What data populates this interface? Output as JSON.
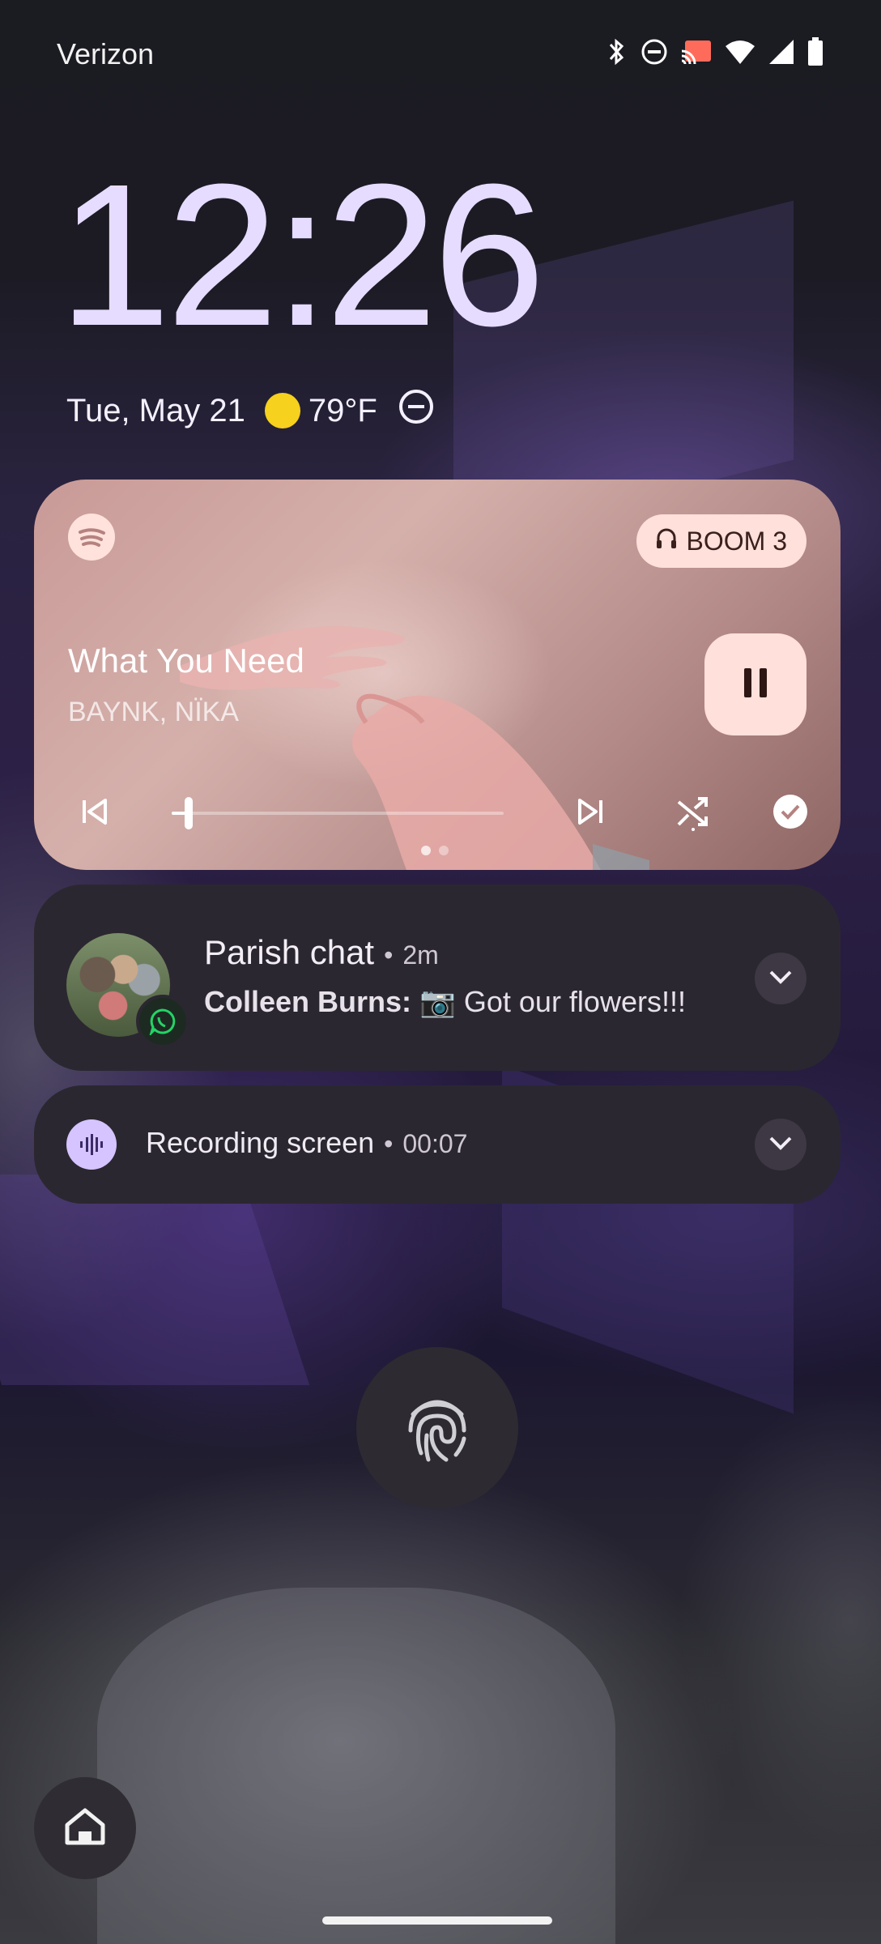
{
  "status_bar": {
    "carrier": "Verizon",
    "icons": [
      "bluetooth-icon",
      "do-not-disturb-icon",
      "cast-icon",
      "wifi-icon",
      "cell-signal-icon",
      "battery-icon"
    ]
  },
  "lockscreen": {
    "time": "12:26",
    "date": "Tue, May 21",
    "weather_icon": "sun-icon",
    "temperature": "79°F",
    "dnd_icon": "do-not-disturb-icon"
  },
  "media": {
    "app_icon": "spotify-icon",
    "output_device": "BOOM 3",
    "title": "What You Need",
    "artist": "BAYNK, NÏKA",
    "state": "playing",
    "progress": 0.05,
    "page_indicator": {
      "pages": 2,
      "current": 0
    },
    "controls": [
      "previous-icon",
      "next-icon",
      "shuffle-icon",
      "liked-check-icon"
    ]
  },
  "notifications": [
    {
      "app_icon": "whatsapp-icon",
      "title": "Parish chat",
      "time": "2m",
      "sender": "Colleen Burns:",
      "message": "📷 Got our flowers!!!"
    },
    {
      "app_icon": "screen-record-icon",
      "title": "Recording screen",
      "time": "00:07"
    }
  ],
  "colors": {
    "clock": "#e6dcff",
    "media_accent": "#ffe0da",
    "notification_bg": "#2b2730",
    "sun": "#f6d11d"
  }
}
